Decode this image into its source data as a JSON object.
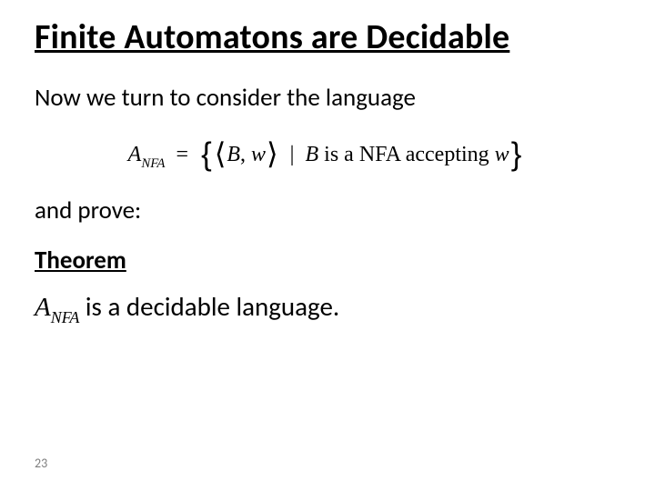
{
  "title": "Finite Automatons are Decidable",
  "intro": "Now we turn to consider the language",
  "formula": {
    "lhs_var": "A",
    "lhs_sub": "NFA",
    "eq": "=",
    "tuple_var1": "B",
    "tuple_comma": ",",
    "tuple_var2": "w",
    "bar": "|",
    "rhs_var": "B",
    "rhs_text1": " is a NFA accepting ",
    "rhs_var2": "w"
  },
  "and_prove": "and prove:",
  "theorem_label": "Theorem",
  "theorem_stmt": {
    "var": "A",
    "sub": "NFA",
    "rest": " is a decidable language."
  },
  "page_number": "23"
}
